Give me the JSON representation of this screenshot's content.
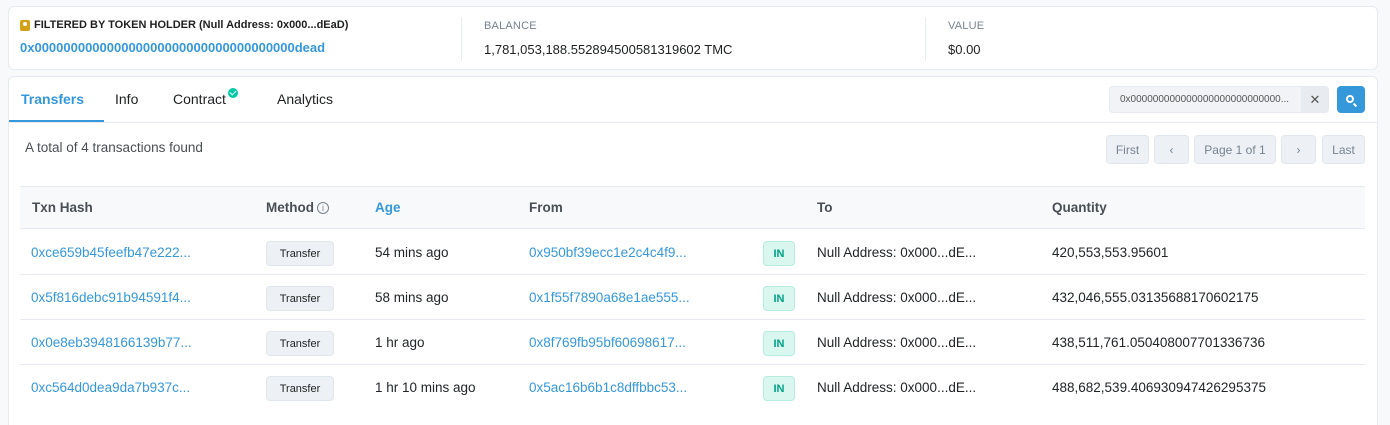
{
  "filter": {
    "title": "FILTERED BY TOKEN HOLDER (Null Address: 0x000...dEaD)",
    "address": "0x000000000000000000000000000000000000dead"
  },
  "balance": {
    "label": "BALANCE",
    "value": "1,781,053,188.552894500581319602 TMC"
  },
  "value": {
    "label": "VALUE",
    "value": "$0.00"
  },
  "tabs": [
    {
      "label": "Transfers",
      "active": true
    },
    {
      "label": "Info",
      "active": false
    },
    {
      "label": "Contract",
      "active": false,
      "verified": true
    },
    {
      "label": "Analytics",
      "active": false
    }
  ],
  "search": {
    "value": "0x000000000000000000000000000..."
  },
  "summary": "A total of 4 transactions found",
  "pagination": {
    "first": "First",
    "page": "Page 1 of 1",
    "last": "Last"
  },
  "table": {
    "headers": {
      "txn_hash": "Txn Hash",
      "method": "Method",
      "age": "Age",
      "from": "From",
      "to": "To",
      "quantity": "Quantity"
    },
    "rows": [
      {
        "txn_hash": "0xce659b45feefb47e222...",
        "method": "Transfer",
        "age": "54 mins ago",
        "from": "0x950bf39ecc1e2c4c4f9...",
        "direction": "IN",
        "to": "Null Address: 0x000...dE...",
        "quantity": "420,553,553.95601"
      },
      {
        "txn_hash": "0x5f816debc91b94591f4...",
        "method": "Transfer",
        "age": "58 mins ago",
        "from": "0x1f55f7890a68e1ae555...",
        "direction": "IN",
        "to": "Null Address: 0x000...dE...",
        "quantity": "432,046,555.03135688170602175"
      },
      {
        "txn_hash": "0x0e8eb3948166139b77...",
        "method": "Transfer",
        "age": "1 hr ago",
        "from": "0x8f769fb95bf60698617...",
        "direction": "IN",
        "to": "Null Address: 0x000...dE...",
        "quantity": "438,511,761.050408007701336736"
      },
      {
        "txn_hash": "0xc564d0dea9da7b937c...",
        "method": "Transfer",
        "age": "1 hr 10 mins ago",
        "from": "0x5ac16b6b1c8dffbbc53...",
        "direction": "IN",
        "to": "Null Address: 0x000...dE...",
        "quantity": "488,682,539.406930947426295375"
      }
    ]
  },
  "colors": {
    "accent": "#3498db",
    "in_badge": "#00a186",
    "verified": "#00c9a7"
  }
}
